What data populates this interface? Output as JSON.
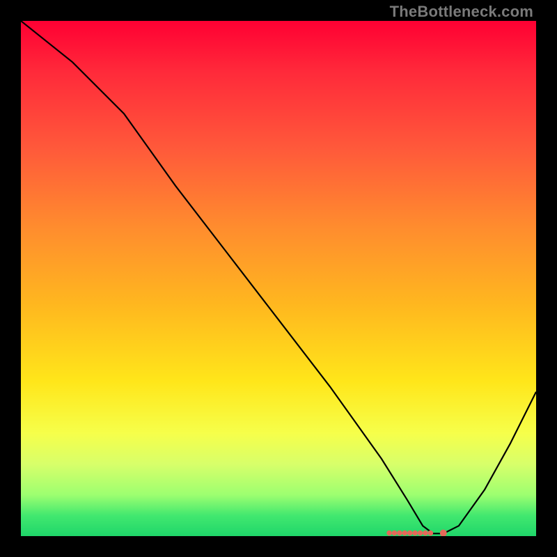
{
  "attribution": "TheBottleneck.com",
  "colors": {
    "background": "#000000",
    "curve": "#000000",
    "dot": "#e36a5a"
  },
  "chart_data": {
    "type": "line",
    "title": "",
    "xlabel": "",
    "ylabel": "",
    "xlim": [
      0,
      100
    ],
    "ylim": [
      0,
      100
    ],
    "grid": false,
    "series": [
      {
        "name": "bottleneck-curve",
        "x": [
          0,
          10,
          20,
          25,
          30,
          40,
          50,
          60,
          70,
          75,
          78,
          80,
          82,
          85,
          90,
          95,
          100
        ],
        "y": [
          100,
          92,
          82,
          75,
          68,
          55,
          42,
          29,
          15,
          7,
          2,
          0.5,
          0.5,
          2,
          9,
          18,
          28
        ]
      }
    ],
    "markers": {
      "name": "sample-dots",
      "color": "#e36a5a",
      "x": [
        71.5,
        72.5,
        73.5,
        74.5,
        75.5,
        76.5,
        77.5,
        78.5,
        79.5,
        82.0
      ],
      "y": [
        0.6,
        0.6,
        0.6,
        0.6,
        0.6,
        0.6,
        0.6,
        0.6,
        0.6,
        0.6
      ]
    }
  }
}
